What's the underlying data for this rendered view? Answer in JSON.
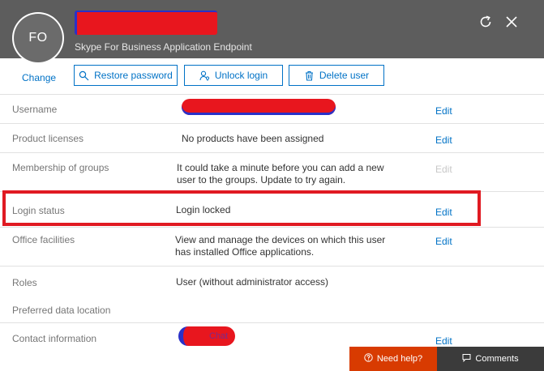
{
  "header": {
    "avatar_initials": "FO",
    "subtitle": "Skype For Business Application Endpoint",
    "background_color": "#5d5d5d",
    "icons": [
      "refresh-icon",
      "close-icon"
    ]
  },
  "actions": {
    "change_label": "Change",
    "restore_password_label": "Restore password",
    "unlock_login_label": "Unlock login",
    "delete_user_label": "Delete user"
  },
  "properties": {
    "username": {
      "label": "Username",
      "edit": "Edit"
    },
    "product_licenses": {
      "label": "Product licenses",
      "value": "No products have been assigned",
      "edit": "Edit"
    },
    "membership_of_groups": {
      "label": "Membership of groups",
      "value_line1": "It could take a minute before you can add a new",
      "value_line2": "user to the groups. Update to try again.",
      "edit": "Edit"
    },
    "login_status": {
      "label": "Login status",
      "value": "Login locked",
      "edit": "Edit"
    },
    "office_facilities": {
      "label": "Office facilities",
      "value_line1": "View and manage the devices on which this user",
      "value_line2": "has installed Office applications.",
      "edit": "Edit"
    },
    "roles": {
      "label": "Roles",
      "value": "User (without administrator access)"
    },
    "preferred_data_location": {
      "label": "Preferred data location"
    },
    "contact_information": {
      "label": "Contact information",
      "value_partial": "Chat",
      "edit": "Edit"
    }
  },
  "footer": {
    "need_help_label": "Need help?",
    "comments_label": "Comments",
    "need_help_color": "#d83b01",
    "comments_color": "#3b3b3b"
  },
  "colors": {
    "accent": "#0072c6",
    "highlight": "#e01a22"
  }
}
